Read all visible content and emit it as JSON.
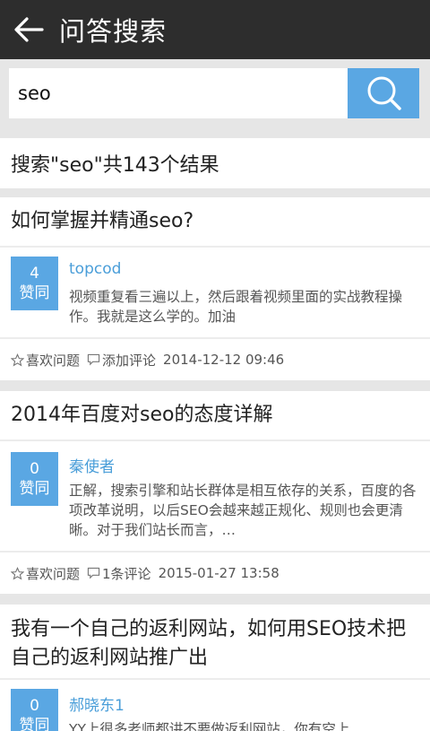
{
  "header": {
    "title": "问答搜索"
  },
  "search": {
    "value": "seo"
  },
  "result_summary": "搜索\"seo\"共143个结果",
  "questions": [
    {
      "title": "如何掌握并精通seo?",
      "answer": {
        "votes": "4",
        "vote_label": "赞同",
        "author": "topcod",
        "text": "视频重复看三遍以上，然后跟着视频里面的实战教程操作。我就是这么学的。加油"
      },
      "like_label": "喜欢问题",
      "comment_label": "添加评论",
      "time": "2014-12-12 09:46"
    },
    {
      "title": "2014年百度对seo的态度详解",
      "answer": {
        "votes": "0",
        "vote_label": "赞同",
        "author": "秦使者",
        "text": "正解，搜索引擎和站长群体是相互依存的关系，百度的各项改革说明，以后SEO会越来越正规化、规则也会更清晰。对于我们站长而言，…"
      },
      "like_label": "喜欢问题",
      "comment_label": "1条评论",
      "time": "2015-01-27 13:58"
    },
    {
      "title": "我有一个自己的返利网站，如何用SEO技术把自己的返利网站推广出",
      "answer": {
        "votes": "0",
        "vote_label": "赞同",
        "author": "郝晓东1",
        "text": "YY上很多老师都讲不要做返利网站，你有空上"
      }
    }
  ]
}
